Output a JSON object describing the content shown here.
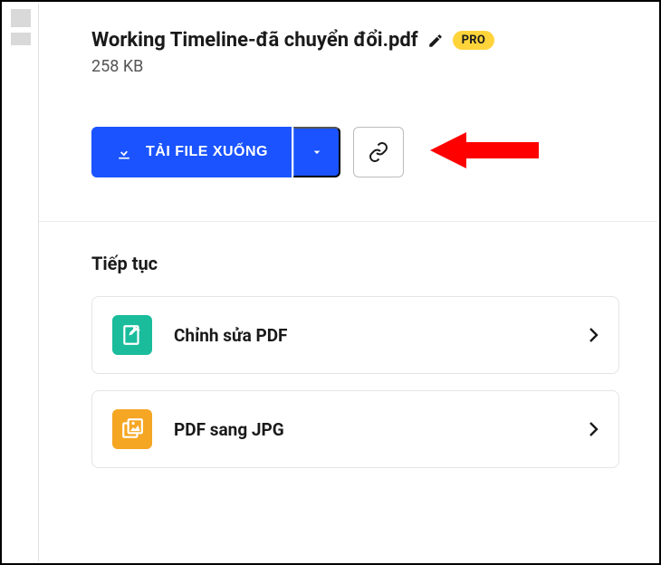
{
  "file": {
    "title": "Working Timeline-đã chuyển đổi.pdf",
    "size": "258 KB"
  },
  "badge": {
    "pro": "PRO"
  },
  "actions": {
    "download_label": "TẢI FILE XUỐNG"
  },
  "section": {
    "continue_label": "Tiếp tục"
  },
  "options": [
    {
      "label": "Chỉnh sửa PDF"
    },
    {
      "label": "PDF sang JPG"
    }
  ]
}
